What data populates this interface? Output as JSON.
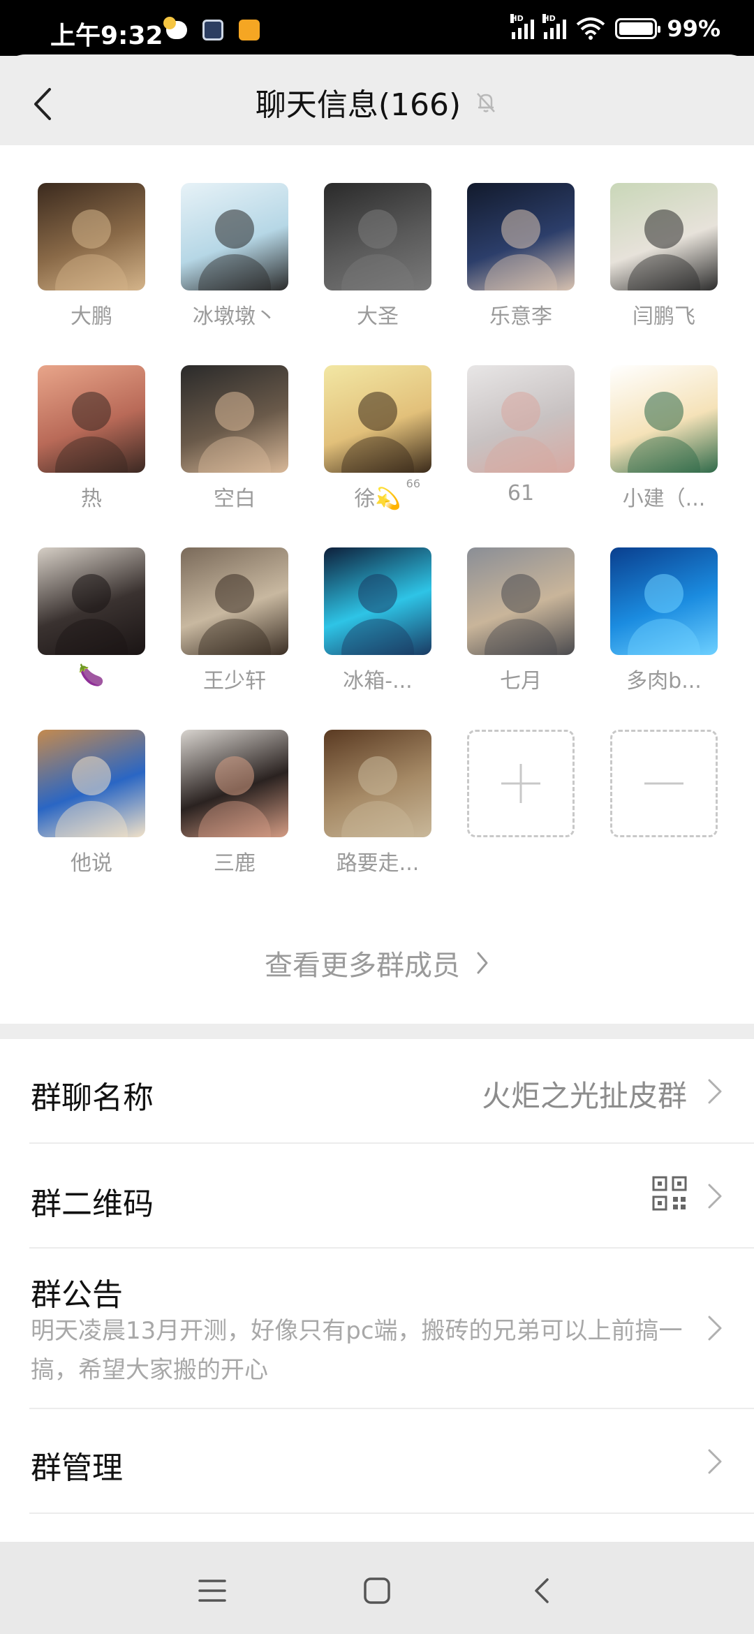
{
  "status_bar": {
    "time": "上午9:32",
    "hd1": "HD",
    "hd2": "HD",
    "battery_pct": "99%",
    "battery_level": 0.99,
    "icons": [
      "weather-icon",
      "app-notification-icon",
      "cloud-app-icon",
      "signal-icon",
      "signal-icon",
      "wifi-icon",
      "battery-icon"
    ]
  },
  "header": {
    "title": "聊天信息(166)",
    "back_icon": "chevron-left-icon",
    "mute_icon": "bell-muted-icon"
  },
  "members": [
    {
      "name": "大鹏",
      "avatar_colors": [
        "#3b2a1e",
        "#8a6a48",
        "#d4b48a"
      ]
    },
    {
      "name": "冰墩墩丶",
      "avatar_colors": [
        "#e7f2f7",
        "#b6d7e6",
        "#2a2a2a"
      ]
    },
    {
      "name": "大圣",
      "avatar_colors": [
        "#2a2a2a",
        "#5a5a5a",
        "#7a7a7a"
      ]
    },
    {
      "name": "乐意李",
      "avatar_colors": [
        "#121a2c",
        "#2c3e6a",
        "#d8c2b0"
      ]
    },
    {
      "name": "闫鹏飞",
      "avatar_colors": [
        "#c9d7b8",
        "#e7e2da",
        "#2c2c2c"
      ]
    },
    {
      "name": "热",
      "avatar_colors": [
        "#e8a58a",
        "#b96a58",
        "#3a2822"
      ]
    },
    {
      "name": "空白",
      "avatar_colors": [
        "#2a2a2a",
        "#6a5a4a",
        "#d8b898"
      ]
    },
    {
      "name": "徐💫",
      "sup": "66",
      "avatar_colors": [
        "#f2e7a4",
        "#e2c07a",
        "#3a2a1a"
      ]
    },
    {
      "name": "61",
      "avatar_colors": [
        "#e8e6e6",
        "#c8c2c2",
        "#d8a8a0"
      ]
    },
    {
      "name": "小建（...",
      "avatar_colors": [
        "#ffffff",
        "#f5e2b8",
        "#2f6a4a"
      ]
    },
    {
      "name": "🍆",
      "avatar_colors": [
        "#d6cfc6",
        "#3a3230",
        "#1a1414"
      ]
    },
    {
      "name": "王少轩",
      "avatar_colors": [
        "#7a6a5a",
        "#c8b8a0",
        "#3a2e24"
      ]
    },
    {
      "name": "冰箱-...",
      "avatar_colors": [
        "#0e1f3a",
        "#2ec4e6",
        "#1a3a62"
      ]
    },
    {
      "name": "七月",
      "avatar_colors": [
        "#8a8e96",
        "#c9b59a",
        "#4a4a4e"
      ]
    },
    {
      "name": "多肉b...",
      "avatar_colors": [
        "#0a3f8e",
        "#1b8ce0",
        "#6ed0ff"
      ]
    },
    {
      "name": "他说",
      "avatar_colors": [
        "#c48a4e",
        "#2a66c4",
        "#f2e2c8"
      ]
    },
    {
      "name": "三鹿",
      "avatar_colors": [
        "#d8d4cf",
        "#2a2220",
        "#d49c84"
      ]
    },
    {
      "name": "路要走...",
      "avatar_colors": [
        "#5a3a22",
        "#a68a66",
        "#c9b89a"
      ]
    }
  ],
  "add_member_icon": "plus-icon",
  "remove_member_icon": "minus-icon",
  "more_members": "查看更多群成员",
  "settings": {
    "group_name_label": "群聊名称",
    "group_name_value": "火炬之光扯皮群",
    "qr_label": "群二维码",
    "qr_icon": "qr-code-icon",
    "notice_label": "群公告",
    "notice_text": "明天凌晨13月开测，好像只有pc端，搬砖的兄弟可以上前搞一搞，希望大家搬的开心",
    "manage_label": "群管理"
  },
  "nav": {
    "icons": [
      "menu-icon",
      "home-icon",
      "back-icon"
    ]
  }
}
